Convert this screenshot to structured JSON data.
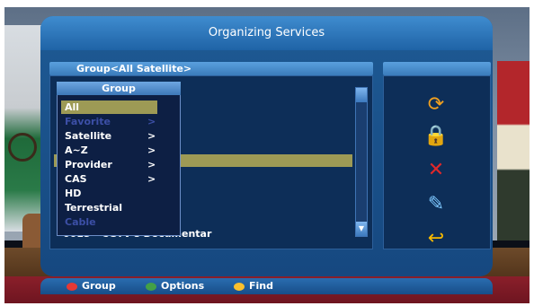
{
  "title": "Organizing Services",
  "list": {
    "header": "Group<All Satellite>",
    "visible_row": "0015 - CGTV's Documentar"
  },
  "popup": {
    "title": "Group",
    "items": [
      {
        "label": "All",
        "arrow": "",
        "state": "selected"
      },
      {
        "label": "Favorite",
        "arrow": ">",
        "state": "disabled"
      },
      {
        "label": "Satellite",
        "arrow": ">",
        "state": "normal"
      },
      {
        "label": "A~Z",
        "arrow": ">",
        "state": "normal"
      },
      {
        "label": "Provider",
        "arrow": ">",
        "state": "normal"
      },
      {
        "label": "CAS",
        "arrow": ">",
        "state": "normal"
      },
      {
        "label": "HD",
        "arrow": "",
        "state": "normal"
      },
      {
        "label": "Terrestrial",
        "arrow": "",
        "state": "normal"
      },
      {
        "label": "Cable",
        "arrow": "",
        "state": "disabled"
      }
    ]
  },
  "side_icons": [
    {
      "name": "move-icon",
      "glyph": "⟳",
      "color": "#f0a020"
    },
    {
      "name": "lock-icon",
      "glyph": "🔒",
      "color": "#f5c400"
    },
    {
      "name": "delete-icon",
      "glyph": "✕",
      "color": "#e0282a"
    },
    {
      "name": "rename-icon",
      "glyph": "✎",
      "color": "#7ec8ff"
    },
    {
      "name": "back-icon",
      "glyph": "↩",
      "color": "#f5b800"
    }
  ],
  "help": [
    {
      "label": "Group",
      "color": "#e53935"
    },
    {
      "label": "Options",
      "color": "#43a047"
    },
    {
      "label": "Find",
      "color": "#fbc02d"
    }
  ],
  "colors": {
    "highlight": "#9d9a55",
    "panel": "#1e5a94",
    "disabled_text": "#3c4fa6"
  }
}
